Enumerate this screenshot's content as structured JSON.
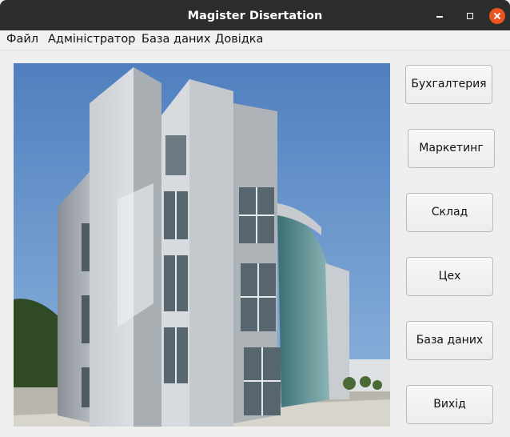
{
  "window": {
    "title": "Magister Disertation"
  },
  "menu": {
    "items": [
      {
        "label": "Файл"
      },
      {
        "label": "Адміністратор"
      },
      {
        "label": "База даних"
      },
      {
        "label": "Довідка"
      }
    ]
  },
  "buttons": {
    "accounting": "Бухгалтерия",
    "marketing": "Маркетинг",
    "warehouse": "Склад",
    "workshop": "Цех",
    "database": "База даних",
    "exit": "Вихід"
  }
}
